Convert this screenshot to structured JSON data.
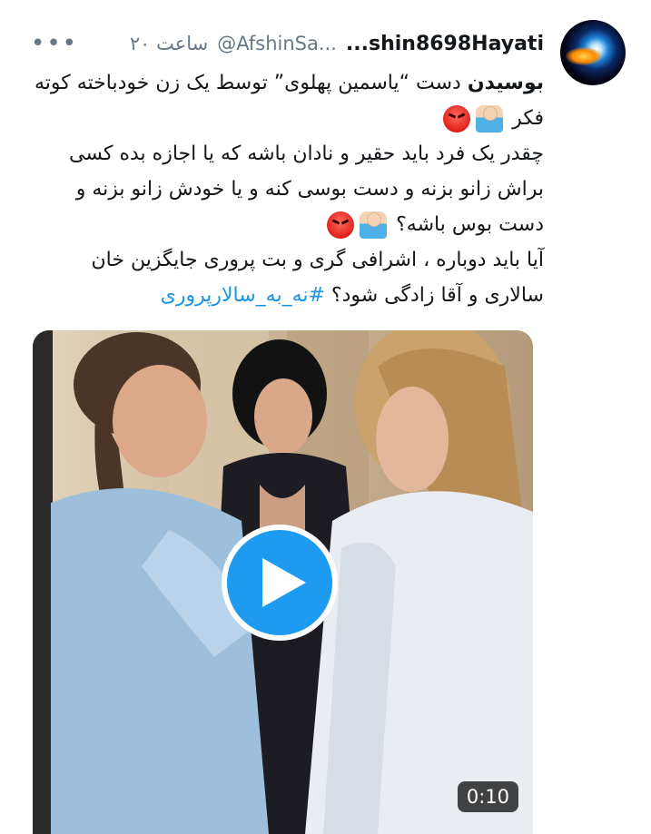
{
  "tweet": {
    "display_name": "...shin8698Hayati",
    "handle": "@AfshinSa...",
    "time": "۲۰ ساعت",
    "more": "•••",
    "paragraphs": [
      {
        "segments": [
          {
            "text": "بوسیدن",
            "style": "bold"
          },
          {
            "text": " دست “یاسمین پهلوی” توسط یک زن خودباخته کوته فکر ",
            "style": "normal"
          }
        ],
        "emojis": [
          "facepalm-emoji",
          "angry-face-emoji"
        ]
      },
      {
        "segments": [
          {
            "text": "چقدر یک فرد باید حقیر و نادان باشه که یا اجازه بده کسی براش زانو بزنه و دست بوسی کنه و یا خودش زانو بزنه و دست بوس باشه؟ ",
            "style": "normal"
          }
        ],
        "emojis": [
          "facepalm-emoji",
          "angry-face-emoji"
        ]
      },
      {
        "segments": [
          {
            "text": "آیا باید دوباره ، اشرافی گری و بت پروری جایگزین خان سالاری و آقا زادگی  شود؟ ",
            "style": "normal"
          },
          {
            "text": "#نه_به_سالارپروری",
            "style": "hashtag"
          }
        ],
        "emojis": []
      }
    ],
    "video": {
      "duration": "0:10"
    }
  },
  "colors": {
    "accent": "#1d9bf0",
    "hashtag": "#1b95e0",
    "muted": "#657786",
    "text": "#14171a"
  }
}
